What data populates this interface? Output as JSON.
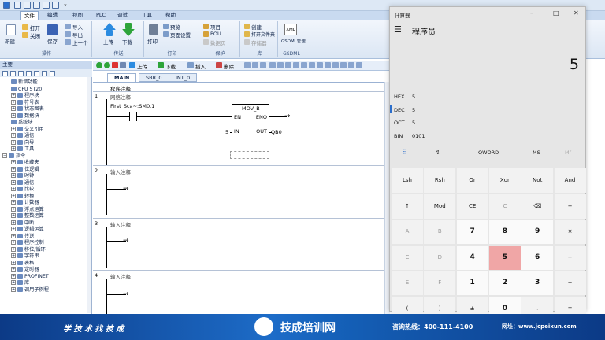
{
  "app": {
    "menu": [
      "文件",
      "编辑",
      "视图",
      "PLC",
      "调试",
      "工具",
      "帮助"
    ]
  },
  "ribbon": {
    "new": "新建",
    "open": "打开",
    "close": "关闭",
    "save": "保存",
    "import": "导入",
    "export": "导出",
    "prev": "上一个",
    "upload": "上传",
    "download": "下载",
    "print": "打印",
    "preview": "预览",
    "page_setup": "页面设置",
    "project": "项目",
    "pou": "POU",
    "data_page": "数据页",
    "create": "创建",
    "open_folder": "打开文件夹",
    "memory_card": "存储器",
    "gsdml_badge": "XML",
    "gsdml": "GSDML管理",
    "groups": {
      "operation": "操作",
      "transfer": "传送",
      "print": "打印",
      "protect": "保护",
      "library": "库",
      "gsdml": "GSDML"
    }
  },
  "toolbar": {
    "upload": "上传",
    "download": "下载",
    "insert": "插入",
    "delete": "删除"
  },
  "left_panel": {
    "title": "主要",
    "tree": [
      "新增功能",
      "CPU ST20",
      "程序块",
      "符号表",
      "状态图表",
      "数据块",
      "系统块",
      "交叉引用",
      "通信",
      "向导",
      "工具",
      "指令",
      "收藏夹",
      "位逻辑",
      "时钟",
      "通信",
      "比较",
      "转换",
      "计数器",
      "浮点运算",
      "整数运算",
      "中断",
      "逻辑运算",
      "传送",
      "程序控制",
      "移位/循环",
      "字符串",
      "表格",
      "定时器",
      "PROFINET",
      "库",
      "调用子例程"
    ]
  },
  "editor": {
    "tabs": [
      "MAIN",
      "SBR_0",
      "INT_0"
    ],
    "program_comment": "程序注释",
    "network_comment": "网络注释",
    "networks": [
      {
        "num": "1",
        "contact": "First_Sca~:SM0.1",
        "box": "MOV_B",
        "en": "EN",
        "eno": "ENO",
        "in_val": "5",
        "in": "IN",
        "out": "OUT",
        "out_val": "QB0"
      },
      {
        "num": "2",
        "comment": "输入注释"
      },
      {
        "num": "3",
        "comment": "输入注释"
      },
      {
        "num": "4",
        "comment": "输入注释"
      }
    ]
  },
  "calculator": {
    "window_title": "计算器",
    "mode": "程序员",
    "display": "5",
    "hex_label": "HEX",
    "hex": "5",
    "dec_label": "DEC",
    "dec": "5",
    "oct_label": "OCT",
    "oct": "5",
    "bin_label": "BIN",
    "bin": "0101",
    "word_size": "QWORD",
    "ms": "MS",
    "mplus": "M˅",
    "rows": [
      [
        "Lsh",
        "Rsh",
        "Or",
        "Xor",
        "Not",
        "And"
      ],
      [
        "↑",
        "Mod",
        "CE",
        "C",
        "⌫",
        "÷"
      ],
      [
        "A",
        "B",
        "7",
        "8",
        "9",
        "×"
      ],
      [
        "C",
        "D",
        "4",
        "5",
        "6",
        "−"
      ],
      [
        "E",
        "F",
        "1",
        "2",
        "3",
        "+"
      ],
      [
        "(",
        ")",
        "±",
        "0",
        ".",
        "="
      ]
    ]
  },
  "banner": {
    "slogan": "学 技 术   找 技 成",
    "brand": "技成培训网",
    "hotline": "咨询热线：400-111-4100",
    "website": "网址：www.jcpeixun.com"
  }
}
